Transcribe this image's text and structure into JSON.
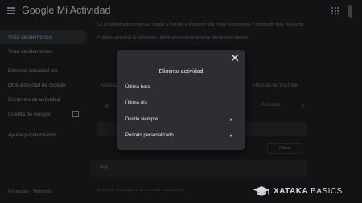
{
  "header": {
    "title": "Google Mi Actividad"
  },
  "sidebar": {
    "items": [
      {
        "label": "Vista de elementos",
        "active": true
      },
      {
        "label": "Vista de elementos"
      },
      {
        "label": "Eliminar actividad por"
      },
      {
        "label": "Otra actividad de Google"
      },
      {
        "label": "Controles de actividad"
      },
      {
        "label": "Cuenta de Google"
      },
      {
        "label": "Ayuda y comentarios"
      }
    ],
    "footer": "Privacidad · Términos"
  },
  "main": {
    "intro_1": "La actividad que conservas ayuda a Google a ofrecerte una mejor experiencia y contenido más relevante.",
    "intro_2": "Puedes consultar tu actividad y eliminarla cuando quieras desde esta página.",
    "card_left": "Actividad en la Web y en Aplicaciones",
    "card_right": "Historial de YouTube",
    "card_status": "Activado",
    "filter": "Filtrar",
    "section_label": "Hoy",
    "note": "Es posible que parte de tu actividad no aparezca"
  },
  "dialog": {
    "title": "Eliminar actividad",
    "options": [
      {
        "label": "Última hora"
      },
      {
        "label": "Último día"
      },
      {
        "label": "Desde siempre"
      },
      {
        "label": "Periodo personalizado"
      }
    ]
  },
  "watermark": {
    "brand": "XATAKA",
    "suffix": "BASICS"
  },
  "icons": {
    "menu": "hamburger-menu-icon",
    "apps": "apps-grid-icon",
    "close": "close-icon",
    "chevron": "chevron-right-icon",
    "watermark": "graduation-cap-icon"
  },
  "colors": {
    "background": "#202124",
    "dialog": "#2d2e31",
    "active_nav_text": "#8ab4f8"
  }
}
